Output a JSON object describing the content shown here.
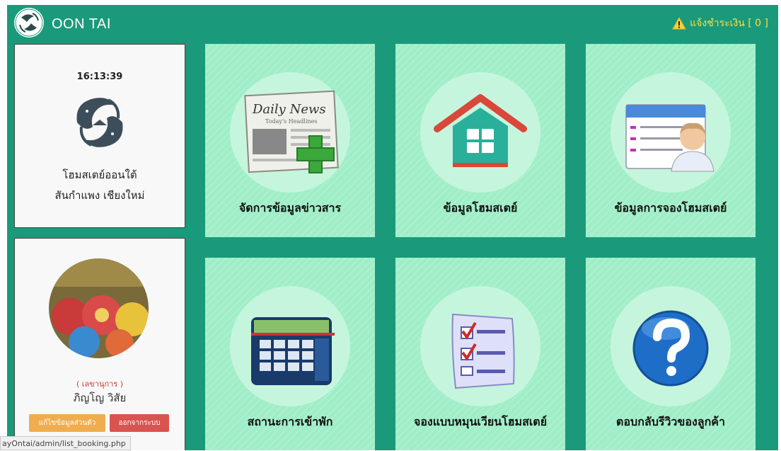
{
  "navbar": {
    "brand_name": "OON TAI",
    "alert_text": "แจ้งชำระเงิน [ 0 ]",
    "alert_icon": "warning-icon"
  },
  "info_card": {
    "time": "16:13:39",
    "homestay_line1": "โฮมสเตย์ออนใต้",
    "homestay_line2": "สันกำแพง เชียงใหม่"
  },
  "profile": {
    "role": "( เลขานุการ )",
    "name": "ภิญโญ วิสัย",
    "edit_label": "แก้ไขข้อมูลส่วนตัว",
    "logout_label": "ออกจากระบบ"
  },
  "tiles": [
    {
      "label": "จัดการข้อมูลข่าวสาร",
      "icon": "newspaper-add-icon",
      "newspaper_title": "Daily News",
      "newspaper_subtitle": "Today's Headlines"
    },
    {
      "label": "ข้อมูลโฮมสเตย์",
      "icon": "house-icon"
    },
    {
      "label": "ข้อมูลการจองโฮมสเตย์",
      "icon": "contact-list-icon"
    },
    {
      "label": "สถานะการเข้าพัก",
      "icon": "calendar-icon"
    },
    {
      "label": "จองแบบหมุนเวียนโฮมสเตย์",
      "icon": "checklist-icon"
    },
    {
      "label": "ตอบกลับรีวิวของลูกค้า",
      "icon": "question-icon"
    }
  ],
  "status_bar": {
    "url": "ayOntai/admin/list_booking.php"
  },
  "colors": {
    "theme_green": "#1a9a7a",
    "tile_green": "#a0eec8",
    "alert_yellow": "#f6e04a",
    "edit_orange": "#f0ad4e",
    "logout_red": "#d9534f"
  }
}
